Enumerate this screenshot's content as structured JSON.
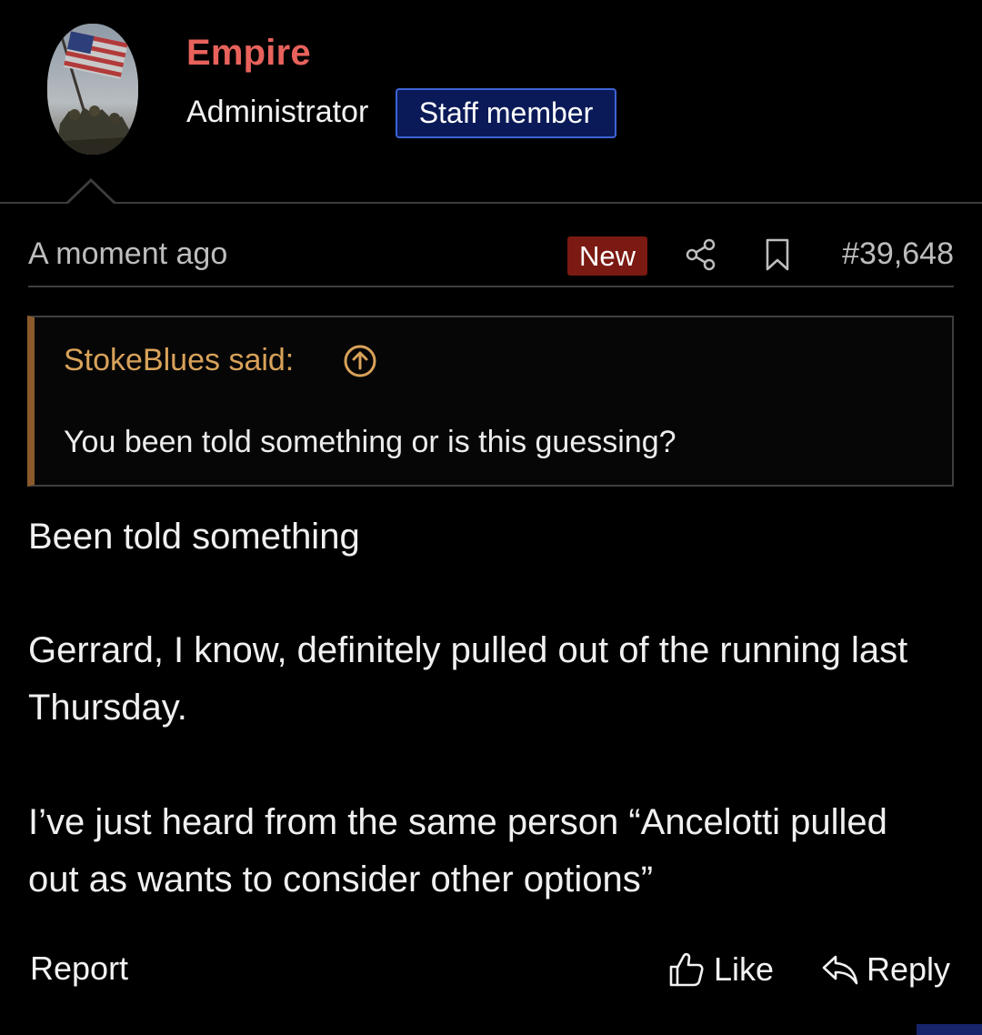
{
  "author": {
    "name": "Empire",
    "title": "Administrator",
    "badge": "Staff member",
    "avatar_icon": "flag-raising-avatar",
    "name_color": "#e8625b"
  },
  "meta": {
    "time": "A moment ago",
    "new_label": "New",
    "share_icon": "share-icon",
    "bookmark_icon": "bookmark-icon",
    "post_number": "#39,648"
  },
  "quote": {
    "author": "StokeBlues said:",
    "arrow_icon": "arrow-up-circle-icon",
    "text": "You been told something or is this guessing?"
  },
  "body": {
    "paragraphs": [
      "Been told something",
      "Gerrard, I know, definitely pulled out of the running last Thursday.",
      "I’ve just heard from the same person “Ancelotti pulled out as wants to consider other options”"
    ]
  },
  "actions": {
    "report": "Report",
    "like": "Like",
    "reply": "Reply"
  },
  "colors": {
    "background": "#000000",
    "badge_bg": "#0a1a58",
    "badge_border": "#3e63d6",
    "new_bg": "#7a1a12",
    "quote_accent": "#8a5a2c",
    "quote_author": "#d8a25a"
  }
}
